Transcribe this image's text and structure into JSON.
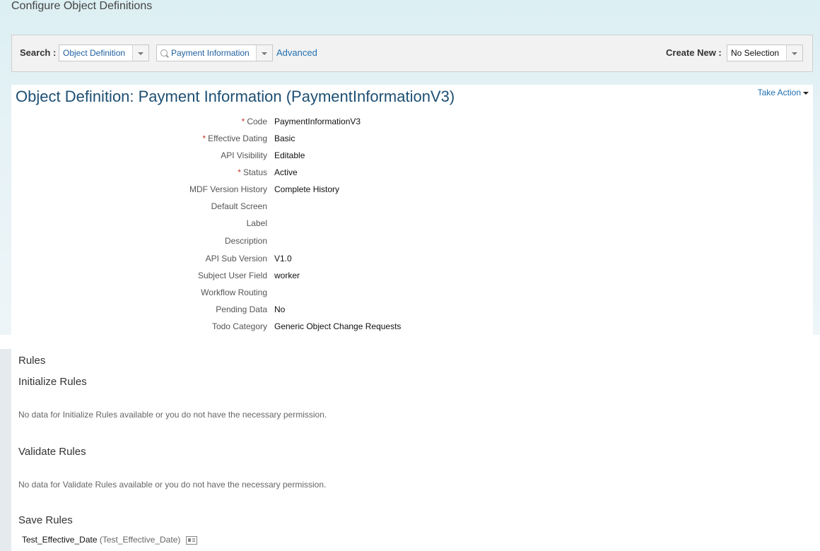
{
  "page": {
    "title": "Configure Object Definitions"
  },
  "search": {
    "label": "Search :",
    "type_value": "Object Definition",
    "object_value": "Payment Information",
    "advanced_link": "Advanced",
    "create_new_label": "Create New :",
    "create_new_value": "No Selection"
  },
  "object": {
    "title": "Object Definition: Payment Information  (PaymentInformationV3)",
    "take_action": "Take Action",
    "fields": [
      {
        "label": "Code",
        "value": "PaymentInformationV3",
        "required": "*"
      },
      {
        "label": "Effective Dating",
        "value": "Basic",
        "required": "*"
      },
      {
        "label": "API Visibility",
        "value": "Editable",
        "required": ""
      },
      {
        "label": "Status",
        "value": "Active",
        "required": "*"
      },
      {
        "label": "MDF Version History",
        "value": "Complete History",
        "required": ""
      },
      {
        "label": "Default Screen",
        "value": "",
        "required": ""
      },
      {
        "label": "Label",
        "value": "",
        "required": ""
      },
      {
        "label": "Description",
        "value": "",
        "required": ""
      },
      {
        "label": "API Sub Version",
        "value": "V1.0",
        "required": ""
      },
      {
        "label": "Subject User Field",
        "value": "worker",
        "required": ""
      },
      {
        "label": "Workflow Routing",
        "value": "",
        "required": ""
      },
      {
        "label": "Pending Data",
        "value": "No",
        "required": ""
      },
      {
        "label": "Todo Category",
        "value": "Generic Object Change Requests",
        "required": ""
      }
    ]
  },
  "rules": {
    "heading": "Rules",
    "initialize": {
      "heading": "Initialize Rules",
      "message": "No data for Initialize Rules available or you do not have the necessary permission."
    },
    "validate": {
      "heading": "Validate Rules",
      "message": "No data for Validate Rules available or you do not have the necessary permission."
    },
    "save": {
      "heading": "Save Rules",
      "item_name": "Test_Effective_Date",
      "item_id": "(Test_Effective_Date)"
    }
  }
}
